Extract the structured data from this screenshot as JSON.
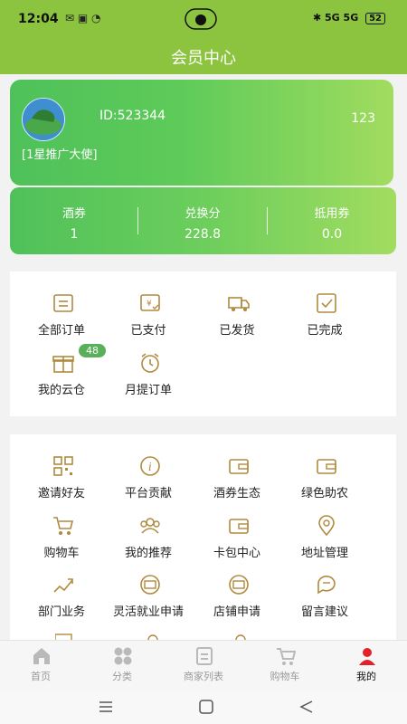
{
  "status": {
    "time": "12:04",
    "signal_text": "5G 5G",
    "battery": "52"
  },
  "header": {
    "title": "会员中心"
  },
  "member": {
    "id_text": "ID:523344",
    "right_value": "123",
    "level": "[1星推广大使]"
  },
  "stats": [
    {
      "label": "酒券",
      "value": "1"
    },
    {
      "label": "兑换分",
      "value": "228.8"
    },
    {
      "label": "抵用券",
      "value": "0.0"
    }
  ],
  "orders": [
    {
      "label": "全部订单",
      "icon": "receipt-icon"
    },
    {
      "label": "已支付",
      "icon": "paid-icon"
    },
    {
      "label": "已发货",
      "icon": "truck-icon"
    },
    {
      "label": "已完成",
      "icon": "check-box-icon"
    },
    {
      "label": "我的云仓",
      "icon": "gift-box-icon",
      "badge": "48"
    },
    {
      "label": "月提订单",
      "icon": "alarm-clock-icon"
    }
  ],
  "services": [
    {
      "label": "邀请好友",
      "icon": "qr-code-icon"
    },
    {
      "label": "平台贡献",
      "icon": "info-icon"
    },
    {
      "label": "酒券生态",
      "icon": "wallet-icon"
    },
    {
      "label": "绿色助农",
      "icon": "wallet-icon"
    },
    {
      "label": "购物车",
      "icon": "cart-icon"
    },
    {
      "label": "我的推荐",
      "icon": "users-icon"
    },
    {
      "label": "卡包中心",
      "icon": "wallet-icon"
    },
    {
      "label": "地址管理",
      "icon": "location-pin-icon"
    },
    {
      "label": "部门业务",
      "icon": "growth-chart-icon"
    },
    {
      "label": "灵活就业申请",
      "icon": "card-icon"
    },
    {
      "label": "店铺申请",
      "icon": "card-icon"
    },
    {
      "label": "留言建议",
      "icon": "chat-icon"
    }
  ],
  "tabs": [
    {
      "label": "首页",
      "icon": "home-icon",
      "active": false
    },
    {
      "label": "分类",
      "icon": "category-icon",
      "active": false
    },
    {
      "label": "商家列表",
      "icon": "list-icon",
      "active": false
    },
    {
      "label": "购物车",
      "icon": "cart-icon",
      "active": false
    },
    {
      "label": "我的",
      "icon": "person-icon",
      "active": true
    }
  ],
  "colors": {
    "accent": "#8cc43f",
    "icon_gold": "#b08a3e",
    "badge": "#5aaf5a",
    "active_tab": "#e0222b"
  }
}
